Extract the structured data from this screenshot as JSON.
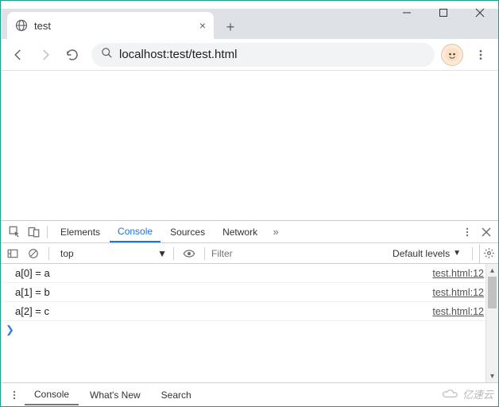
{
  "window": {
    "minimize": "–",
    "maximize": "□",
    "close": "×"
  },
  "tab": {
    "title": "test",
    "close": "×",
    "new": "+"
  },
  "toolbar": {
    "url": "localhost:test/test.html"
  },
  "devtools": {
    "tabs": [
      "Elements",
      "Console",
      "Sources",
      "Network"
    ],
    "active_tab": "Console",
    "more": "»",
    "context": "top",
    "filter_placeholder": "Filter",
    "levels": "Default levels",
    "console_rows": [
      {
        "msg": "a[0] = a",
        "src": "test.html:12"
      },
      {
        "msg": "a[1] = b",
        "src": "test.html:12"
      },
      {
        "msg": "a[2] = c",
        "src": "test.html:12"
      }
    ],
    "prompt": ">",
    "drawer_tabs": [
      "Console",
      "What's New",
      "Search"
    ]
  },
  "watermark": "亿速云"
}
